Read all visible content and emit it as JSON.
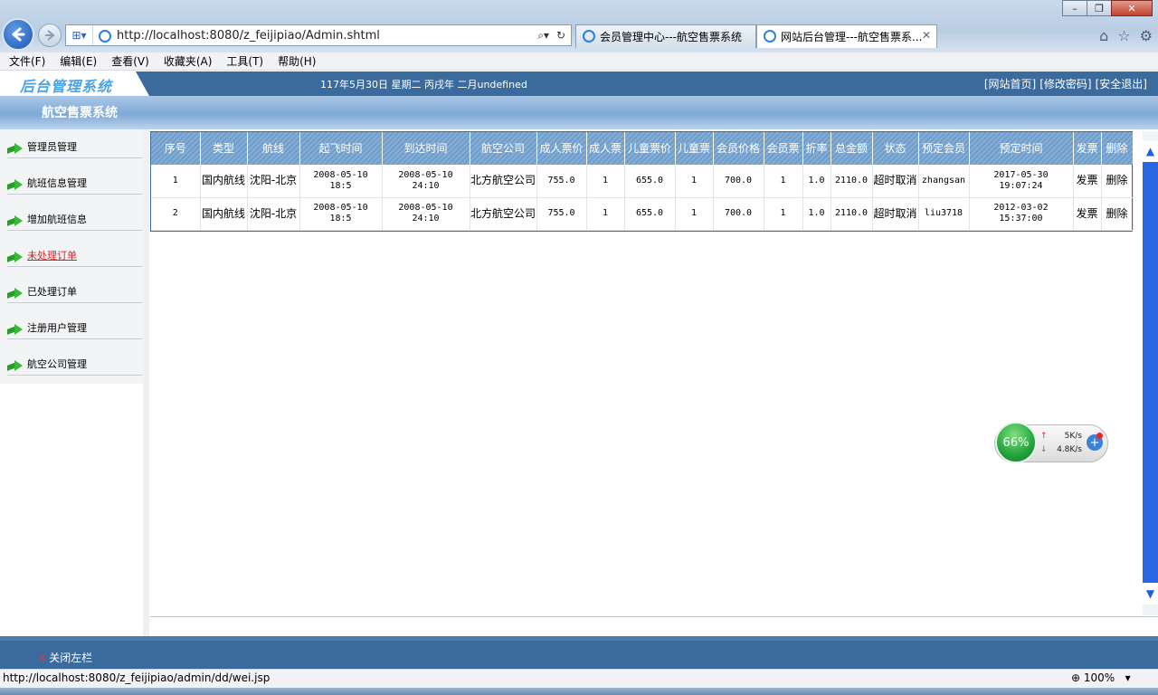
{
  "browser": {
    "url": "http://localhost:8080/z_feijipiao/Admin.shtml",
    "tabs": [
      {
        "title": "会员管理中心---航空售票系统"
      },
      {
        "title": "网站后台管理---航空售票系..."
      }
    ],
    "menu": [
      "文件(F)",
      "编辑(E)",
      "查看(V)",
      "收藏夹(A)",
      "工具(T)",
      "帮助(H)"
    ],
    "status_url": "http://localhost:8080/z_feijipiao/admin/dd/wei.jsp",
    "zoom": "100%"
  },
  "header": {
    "logo": "后台管理系统",
    "date": "117年5月30日 星期二 丙戌年 二月undefined",
    "links": [
      "[网站首页]",
      "[修改密码]",
      "[安全退出]"
    ],
    "system_name": "航空售票系统"
  },
  "sidebar": {
    "items": [
      {
        "label": "管理员管理"
      },
      {
        "label": "航班信息管理"
      },
      {
        "label": "增加航班信息"
      },
      {
        "label": "未处理订单"
      },
      {
        "label": "已处理订单"
      },
      {
        "label": "注册用户管理"
      },
      {
        "label": "航空公司管理"
      }
    ]
  },
  "table": {
    "headers": [
      "序号",
      "类型",
      "航线",
      "起飞时间",
      "到达时间",
      "航空公司",
      "成人票价",
      "成人票",
      "儿童票价",
      "儿童票",
      "会员价格",
      "会员票",
      "折率",
      "总金额",
      "状态",
      "预定会员",
      "预定时间",
      "发票",
      "删除"
    ],
    "rows": [
      [
        "1",
        "国内航线",
        "沈阳-北京",
        "2008-05-10 18:5",
        "2008-05-10 24:10",
        "北方航空公司",
        "755.0",
        "1",
        "655.0",
        "1",
        "700.0",
        "1",
        "1.0",
        "2110.0",
        "超时取消",
        "zhangsan",
        "2017-05-30 19:07:24",
        "发票",
        "删除"
      ],
      [
        "2",
        "国内航线",
        "沈阳-北京",
        "2008-05-10 18:5",
        "2008-05-10 24:10",
        "北方航空公司",
        "755.0",
        "1",
        "655.0",
        "1",
        "700.0",
        "1",
        "1.0",
        "2110.0",
        "超时取消",
        "liu3718",
        "2012-03-02 15:37:00",
        "发票",
        "删除"
      ]
    ]
  },
  "net_widget": {
    "percent": "66%",
    "up": "5K/s",
    "down": "4.8K/s"
  },
  "footer": {
    "close_left": "关闭左栏"
  },
  "colors": {
    "header_blue": "#3b6b9d",
    "table_header": "#7fa8d2",
    "active_link": "#e41b1b"
  }
}
